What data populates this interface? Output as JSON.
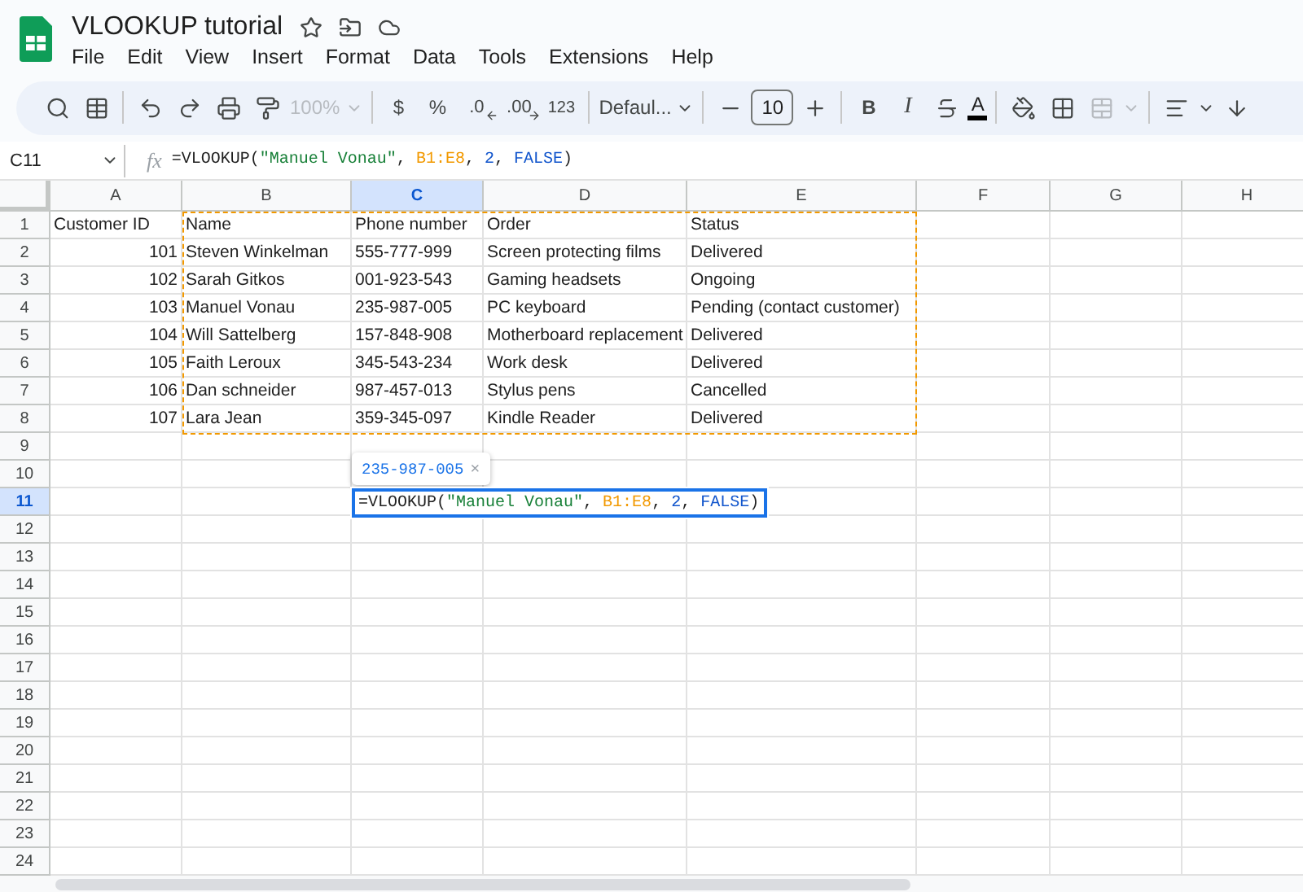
{
  "document": {
    "title": "VLOOKUP tutorial"
  },
  "menu": [
    "File",
    "Edit",
    "View",
    "Insert",
    "Format",
    "Data",
    "Tools",
    "Extensions",
    "Help"
  ],
  "toolbar": {
    "zoom": {
      "label": "100%",
      "disabled": true
    },
    "currency": "$",
    "percent": "%",
    "decrease_decimal": ".0",
    "increase_decimal": ".00",
    "number_format": "123",
    "font": "Defaul...",
    "font_size": "10",
    "bold": "B",
    "italic": "I",
    "text_color": "A",
    "merge": {
      "disabled": true
    }
  },
  "formula_bar": {
    "cell_ref": "C11",
    "fx_label": "fx",
    "formula": [
      {
        "kind": "plain",
        "text": "=VLOOKUP("
      },
      {
        "kind": "string",
        "text": "\"Manuel Vonau\""
      },
      {
        "kind": "plain",
        "text": ", "
      },
      {
        "kind": "range",
        "text": "B1:E8"
      },
      {
        "kind": "plain",
        "text": ", "
      },
      {
        "kind": "number",
        "text": "2"
      },
      {
        "kind": "plain",
        "text": ", "
      },
      {
        "kind": "keyword",
        "text": "FALSE"
      },
      {
        "kind": "plain",
        "text": ")"
      }
    ]
  },
  "columns": [
    {
      "label": "A",
      "selected": false
    },
    {
      "label": "B",
      "selected": false
    },
    {
      "label": "C",
      "selected": true
    },
    {
      "label": "D",
      "selected": false
    },
    {
      "label": "E",
      "selected": false
    },
    {
      "label": "F",
      "selected": false
    },
    {
      "label": "G",
      "selected": false
    },
    {
      "label": "H",
      "selected": false
    }
  ],
  "rows": [
    {
      "header": "1",
      "selected": false,
      "cells": [
        "Customer ID",
        "Name",
        "Phone number",
        "Order",
        "Status"
      ]
    },
    {
      "header": "2",
      "selected": false,
      "cells": [
        "101",
        "Steven Winkelman",
        "555-777-999",
        "Screen protecting films",
        "Delivered"
      ]
    },
    {
      "header": "3",
      "selected": false,
      "cells": [
        "102",
        "Sarah Gitkos",
        "001-923-543",
        "Gaming headsets",
        "Ongoing"
      ]
    },
    {
      "header": "4",
      "selected": false,
      "cells": [
        "103",
        "Manuel Vonau",
        "235-987-005",
        "PC keyboard",
        "Pending (contact customer)"
      ]
    },
    {
      "header": "5",
      "selected": false,
      "cells": [
        "104",
        "Will Sattelberg",
        "157-848-908",
        "Motherboard replacement",
        "Delivered"
      ]
    },
    {
      "header": "6",
      "selected": false,
      "cells": [
        "105",
        "Faith Leroux",
        "345-543-234",
        "Work desk",
        "Delivered"
      ]
    },
    {
      "header": "7",
      "selected": false,
      "cells": [
        "106",
        "Dan schneider",
        "987-457-013",
        "Stylus pens",
        "Cancelled"
      ]
    },
    {
      "header": "8",
      "selected": false,
      "cells": [
        "107",
        "Lara Jean",
        "359-345-097",
        "Kindle Reader",
        "Delivered"
      ]
    },
    {
      "header": "9",
      "selected": false
    },
    {
      "header": "10",
      "selected": false
    },
    {
      "header": "11",
      "selected": true
    },
    {
      "header": "12",
      "selected": false
    },
    {
      "header": "13",
      "selected": false
    },
    {
      "header": "14",
      "selected": false
    },
    {
      "header": "15",
      "selected": false
    },
    {
      "header": "16",
      "selected": false
    },
    {
      "header": "17",
      "selected": false
    },
    {
      "header": "18",
      "selected": false
    },
    {
      "header": "19",
      "selected": false
    },
    {
      "header": "20",
      "selected": false
    },
    {
      "header": "21",
      "selected": false
    },
    {
      "header": "22",
      "selected": false
    },
    {
      "header": "23",
      "selected": false
    },
    {
      "header": "24",
      "selected": false
    }
  ],
  "cell_editor": {
    "formula": [
      {
        "kind": "plain",
        "text": "=VLOOKUP("
      },
      {
        "kind": "string",
        "text": "\"Manuel Vonau\""
      },
      {
        "kind": "plain",
        "text": ", "
      },
      {
        "kind": "range",
        "text": "B1:E8"
      },
      {
        "kind": "plain",
        "text": ", "
      },
      {
        "kind": "number",
        "text": "2"
      },
      {
        "kind": "plain",
        "text": ", "
      },
      {
        "kind": "keyword",
        "text": "FALSE"
      },
      {
        "kind": "plain",
        "text": ")"
      }
    ],
    "preview": {
      "value": "235-987-005",
      "close": "×"
    }
  }
}
